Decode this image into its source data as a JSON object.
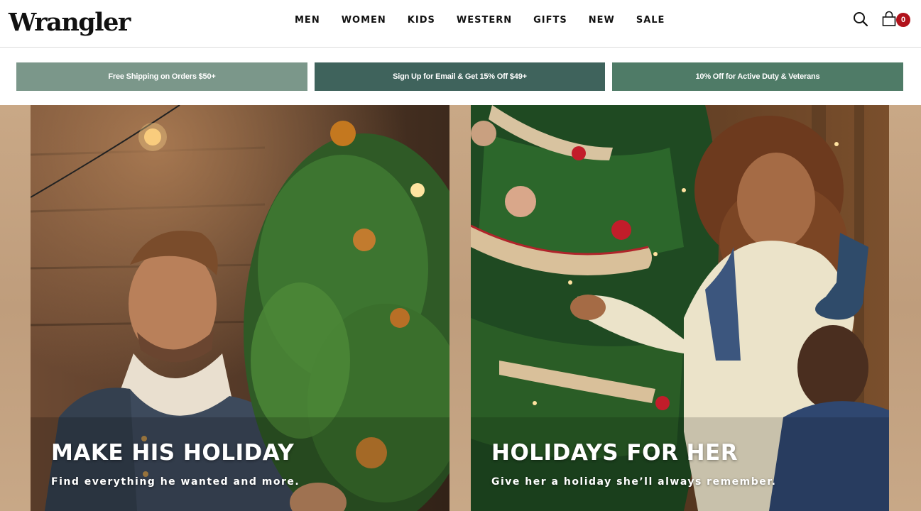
{
  "brand": {
    "logo_text": "Wrangler"
  },
  "nav": {
    "items": [
      {
        "label": "MEN"
      },
      {
        "label": "WOMEN"
      },
      {
        "label": "KIDS"
      },
      {
        "label": "WESTERN"
      },
      {
        "label": "GIFTS"
      },
      {
        "label": "NEW"
      },
      {
        "label": "SALE"
      }
    ]
  },
  "header_icons": {
    "search": "search-icon",
    "cart": "shopping-bag-icon",
    "cart_count": "0",
    "badge_color": "#b1121b"
  },
  "promos": [
    {
      "text": "Free Shipping on Orders $50+",
      "color": "#7b978a"
    },
    {
      "text": "Sign Up for Email & Get 15% Off $49+",
      "color": "#3f635c"
    },
    {
      "text": "10% Off for Active Duty & Veterans",
      "color": "#4f7b67"
    }
  ],
  "hero": {
    "tiles": [
      {
        "title": "MAKE HIS HOLIDAY",
        "subtitle": "Find everything he wanted and more."
      },
      {
        "title": "HOLIDAYS FOR HER",
        "subtitle": "Give her a holiday she’ll always remember."
      }
    ]
  }
}
